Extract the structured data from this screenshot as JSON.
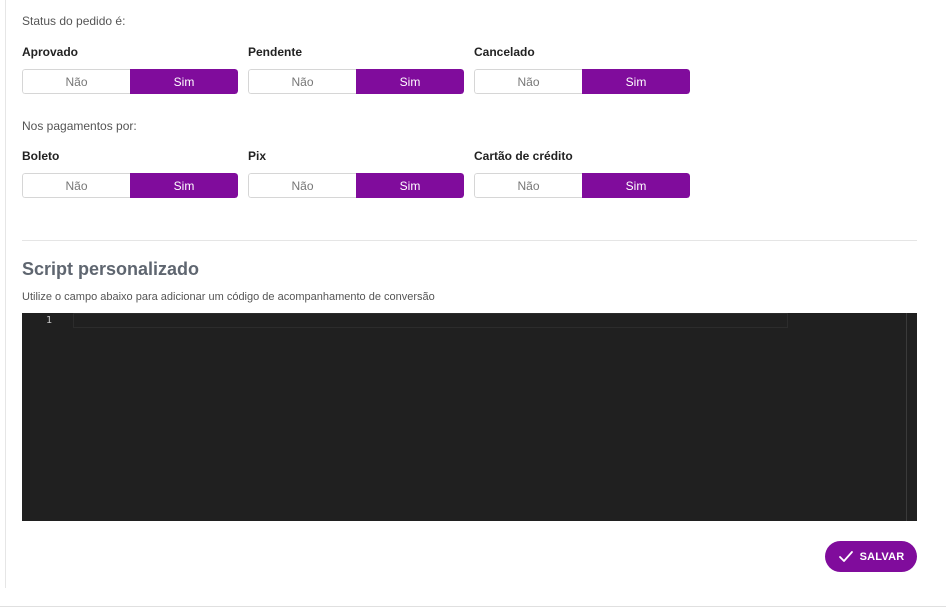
{
  "order_status": {
    "label": "Status do pedido é:",
    "groups": [
      {
        "title": "Aprovado",
        "no_label": "Não",
        "yes_label": "Sim",
        "selected": "Sim"
      },
      {
        "title": "Pendente",
        "no_label": "Não",
        "yes_label": "Sim",
        "selected": "Sim"
      },
      {
        "title": "Cancelado",
        "no_label": "Não",
        "yes_label": "Sim",
        "selected": "Sim"
      }
    ]
  },
  "payments": {
    "label": "Nos pagamentos por:",
    "groups": [
      {
        "title": "Boleto",
        "no_label": "Não",
        "yes_label": "Sim",
        "selected": "Sim"
      },
      {
        "title": "Pix",
        "no_label": "Não",
        "yes_label": "Sim",
        "selected": "Sim"
      },
      {
        "title": "Cartão de crédito",
        "no_label": "Não",
        "yes_label": "Sim",
        "selected": "Sim"
      }
    ]
  },
  "script": {
    "title": "Script personalizado",
    "description": "Utilize o campo abaixo para adicionar um código de acompanhamento de conversão",
    "line_number": "1",
    "content": ""
  },
  "save_button": {
    "label": "SALVAR",
    "icon": "check-icon"
  },
  "colors": {
    "accent": "#800c9c",
    "editor_bg": "#202020"
  }
}
